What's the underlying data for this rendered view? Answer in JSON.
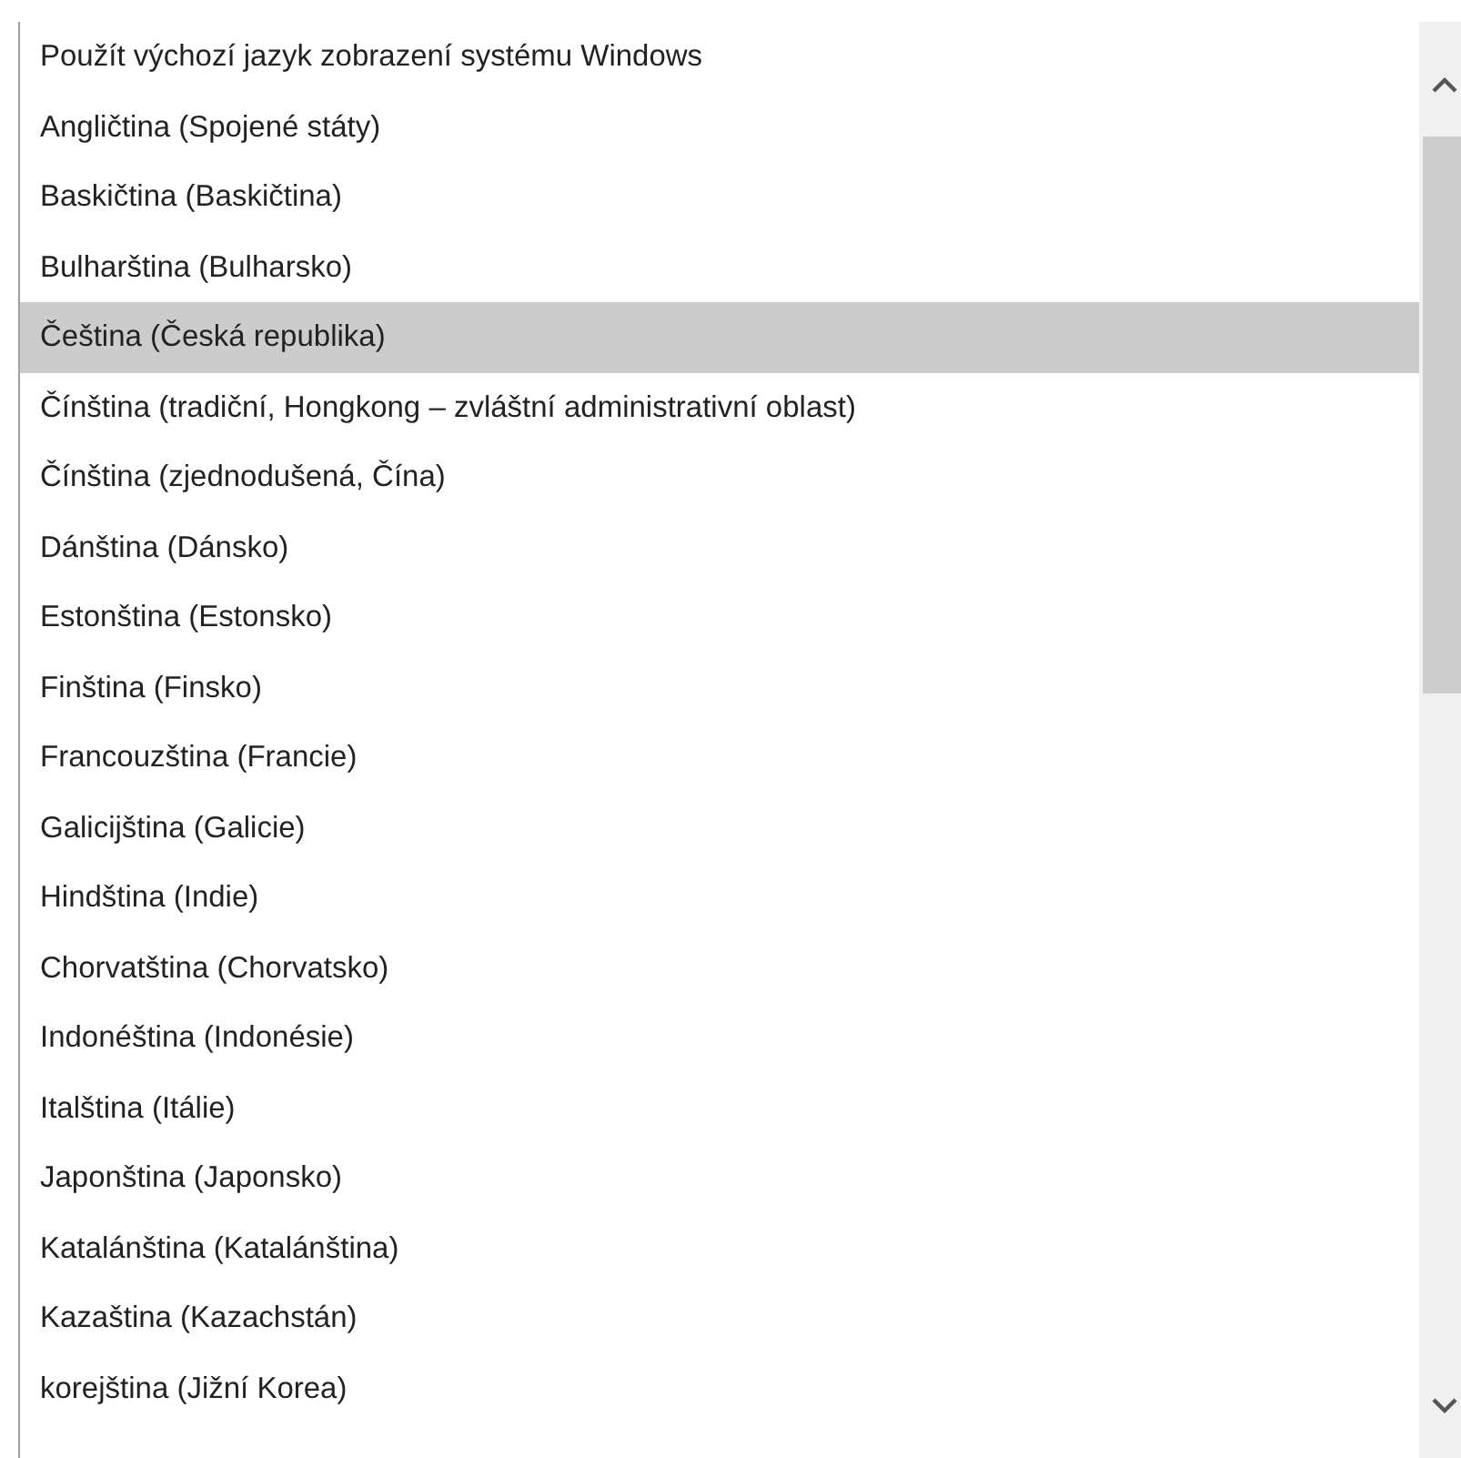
{
  "language_list": {
    "items": [
      {
        "label": "Použít výchozí jazyk zobrazení systému Windows",
        "selected": false
      },
      {
        "label": "Angličtina (Spojené státy)",
        "selected": false
      },
      {
        "label": "Baskičtina (Baskičtina)",
        "selected": false
      },
      {
        "label": "Bulharština (Bulharsko)",
        "selected": false
      },
      {
        "label": "Čeština (Česká republika)",
        "selected": true
      },
      {
        "label": "Čínština (tradiční, Hongkong – zvláštní administrativní oblast)",
        "selected": false
      },
      {
        "label": "Čínština (zjednodušená, Čína)",
        "selected": false
      },
      {
        "label": "Dánština (Dánsko)",
        "selected": false
      },
      {
        "label": "Estonština (Estonsko)",
        "selected": false
      },
      {
        "label": "Finština (Finsko)",
        "selected": false
      },
      {
        "label": "Francouzština (Francie)",
        "selected": false
      },
      {
        "label": "Galicijština (Galicie)",
        "selected": false
      },
      {
        "label": "Hindština (Indie)",
        "selected": false
      },
      {
        "label": "Chorvatština (Chorvatsko)",
        "selected": false
      },
      {
        "label": "Indonéština (Indonésie)",
        "selected": false
      },
      {
        "label": "Italština (Itálie)",
        "selected": false
      },
      {
        "label": "Japonština (Japonsko)",
        "selected": false
      },
      {
        "label": "Katalánština (Katalánština)",
        "selected": false
      },
      {
        "label": "Kazaština (Kazachstán)",
        "selected": false
      },
      {
        "label": "korejština (Jižní Korea)",
        "selected": false
      }
    ]
  }
}
